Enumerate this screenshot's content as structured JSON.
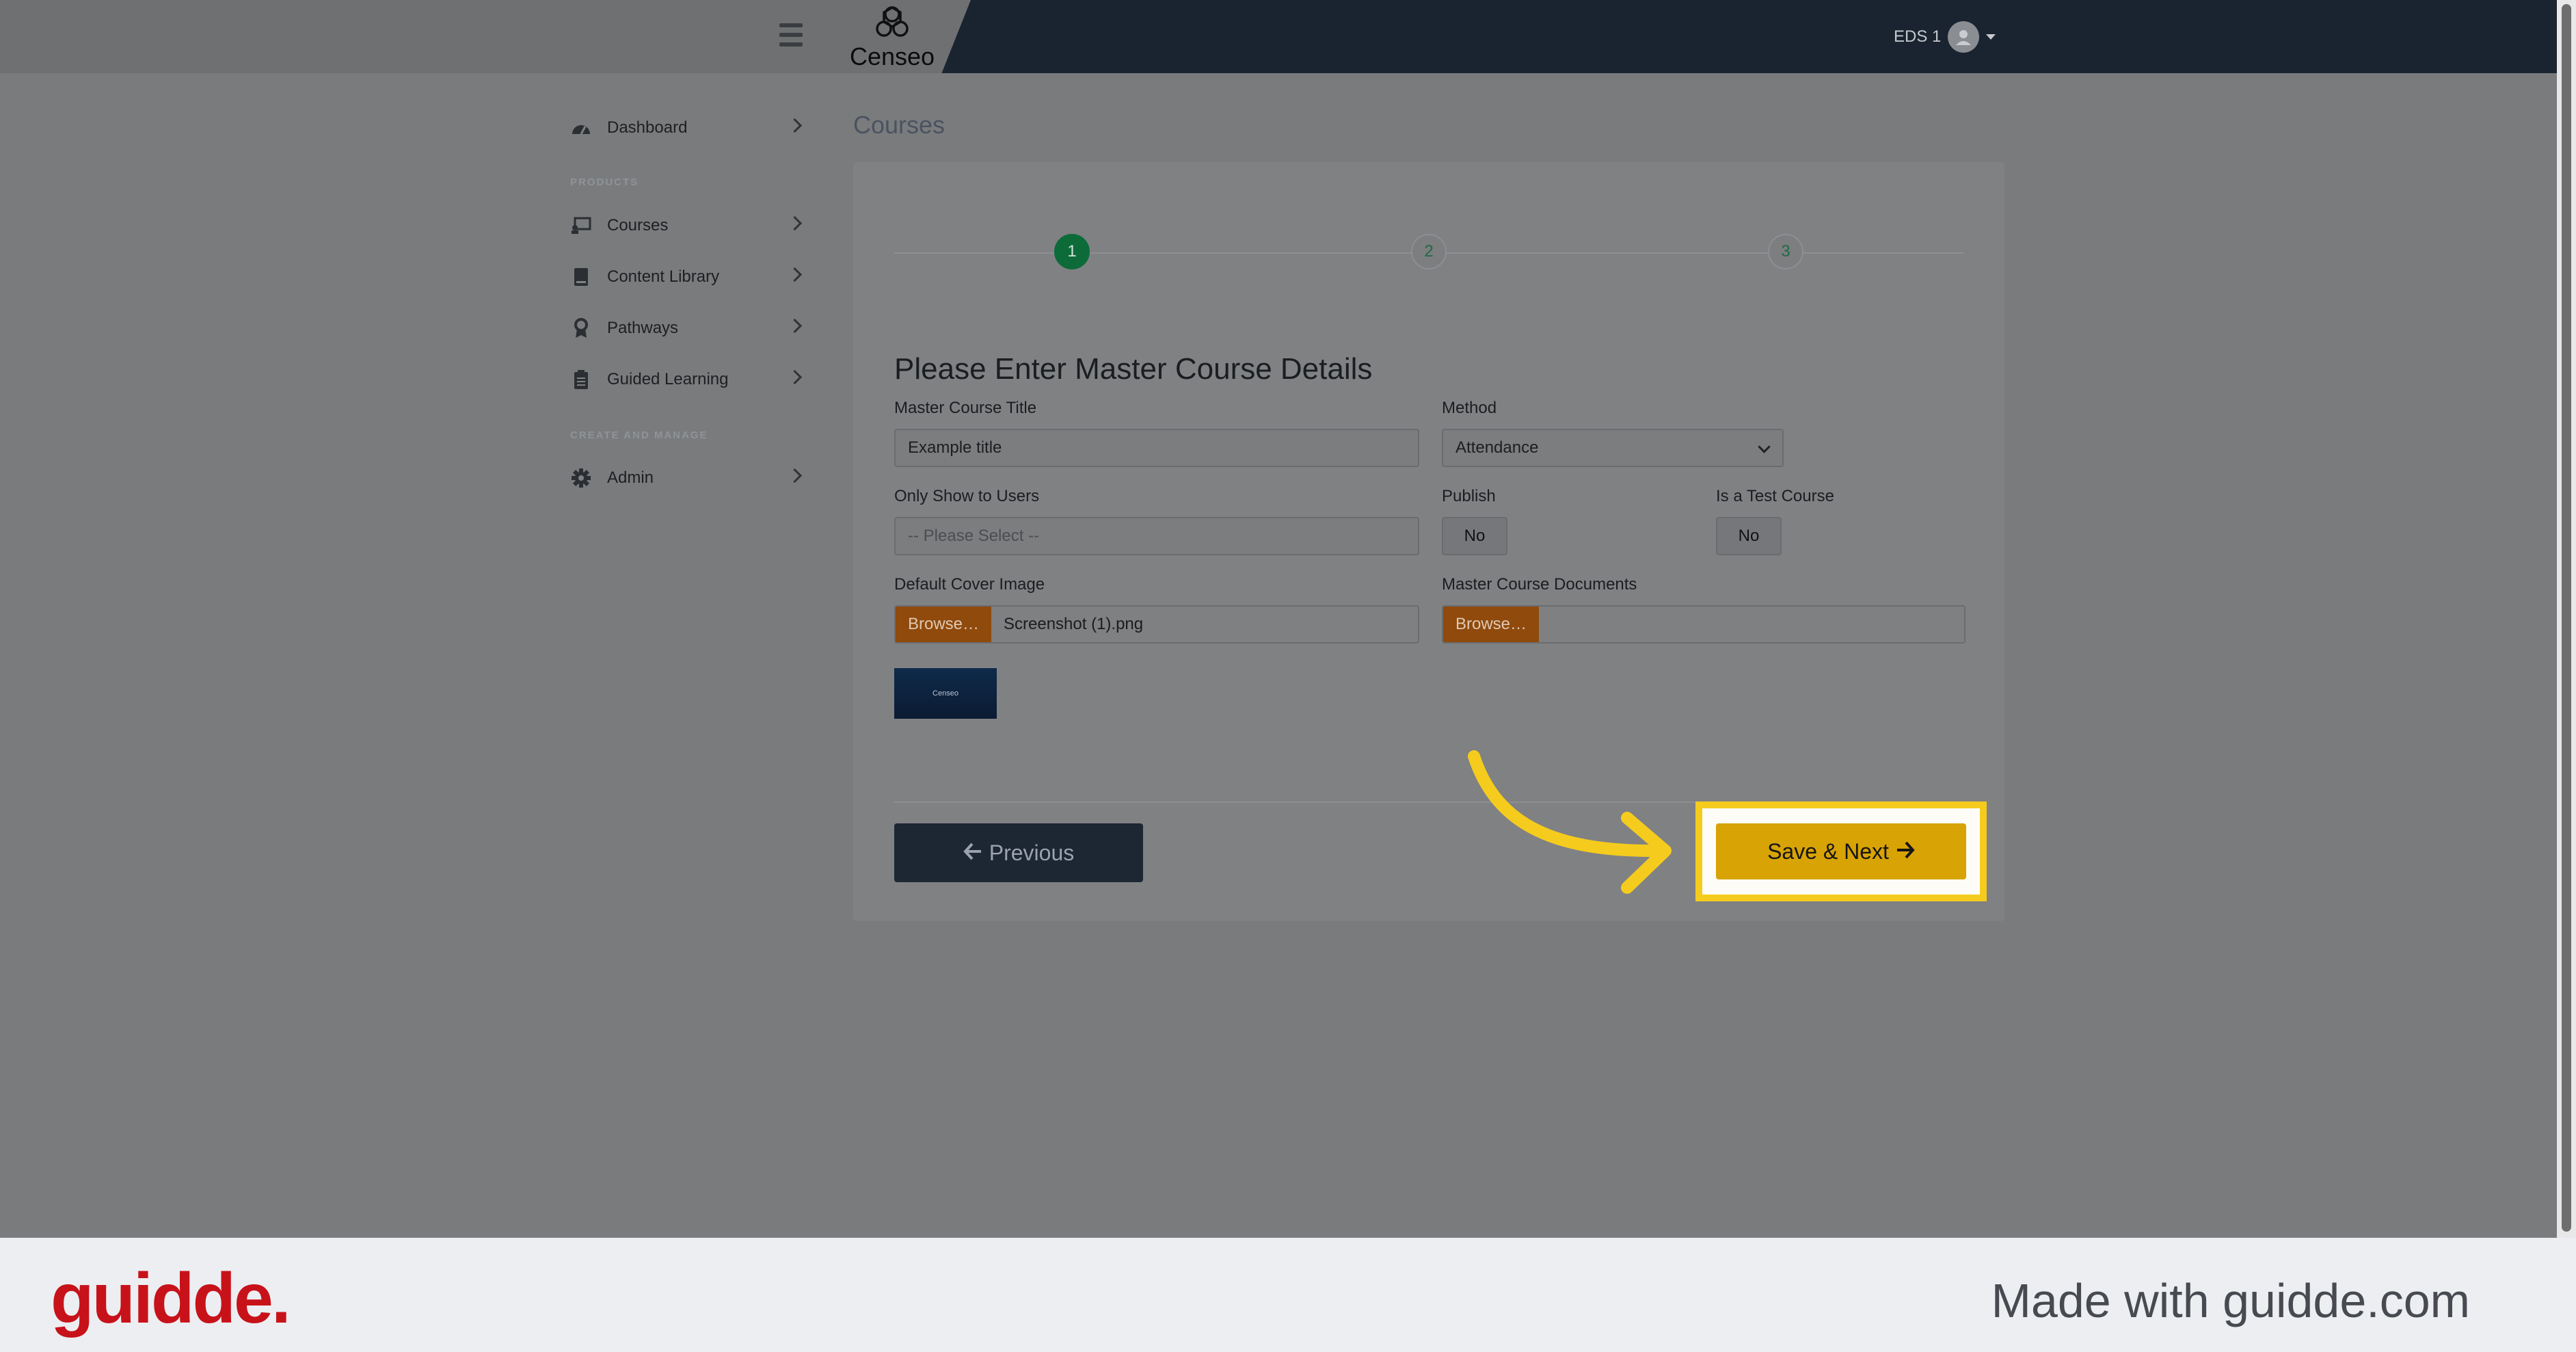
{
  "header": {
    "logo_text": "Censeo",
    "user_label": "EDS 1"
  },
  "sidebar": {
    "items": [
      {
        "label": "Dashboard"
      },
      {
        "label": "Courses"
      },
      {
        "label": "Content Library"
      },
      {
        "label": "Pathways"
      },
      {
        "label": "Guided Learning"
      },
      {
        "label": "Admin"
      }
    ],
    "section_products": "PRODUCTS",
    "section_create": "CREATE AND MANAGE"
  },
  "page": {
    "title": "Courses"
  },
  "wizard": {
    "steps": [
      "1",
      "2",
      "3"
    ],
    "active_step": 1,
    "heading": "Please Enter Master Course Details",
    "fields": {
      "title_label": "Master Course Title",
      "title_value": "Example title",
      "method_label": "Method",
      "method_value": "Attendance",
      "users_label": "Only Show to Users",
      "users_placeholder": "-- Please Select --",
      "publish_label": "Publish",
      "publish_value": "No",
      "test_label": "Is a Test Course",
      "test_value": "No",
      "cover_label": "Default Cover Image",
      "cover_browse": "Browse…",
      "cover_file": "Screenshot (1).png",
      "docs_label": "Master Course Documents",
      "docs_browse": "Browse…"
    },
    "thumbnail_text": "Censeo",
    "prev_label": "Previous",
    "save_label": "Save & Next"
  },
  "colors": {
    "highlight": "#f5cc1d",
    "save_button": "#d8a305",
    "browse_button": "#8f4a0c",
    "step_active": "#0d6b3a",
    "brand_red": "#c8121a"
  },
  "footer": {
    "brand": "guidde.",
    "made_with": "Made with guidde.com"
  }
}
